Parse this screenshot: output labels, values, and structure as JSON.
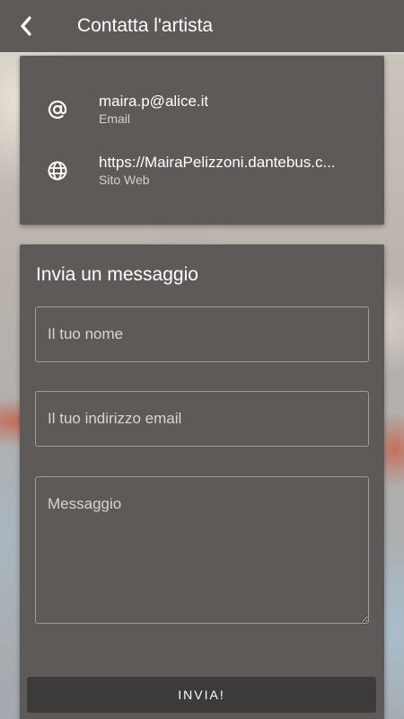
{
  "header": {
    "title": "Contatta l'artista",
    "back_icon": "chevron-left-icon"
  },
  "contacts": {
    "email": {
      "value": "maira.p@alice.it",
      "label": "Email",
      "icon": "at-sign-icon"
    },
    "website": {
      "value": "https://MairaPelizzoni.dantebus.c...",
      "label": "Sito Web",
      "icon": "globe-icon"
    }
  },
  "form": {
    "title": "Invia un messaggio",
    "name_placeholder": "Il tuo nome",
    "email_placeholder": "Il tuo indirizzo email",
    "message_placeholder": "Messaggio",
    "submit_label": "INVIA!"
  },
  "colors": {
    "surface": "#5e5a57",
    "button": "#3c3b3a",
    "text": "#ffffff"
  }
}
